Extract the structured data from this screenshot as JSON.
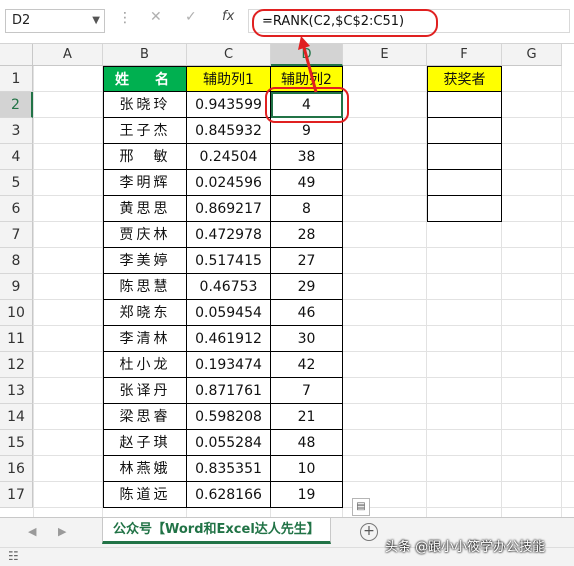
{
  "name_box": "D2",
  "formula": "=RANK(C2,$C$2:C51)",
  "columns": [
    "A",
    "B",
    "C",
    "D",
    "E",
    "F",
    "G"
  ],
  "rows": [
    "1",
    "2",
    "3",
    "4",
    "5",
    "6",
    "7",
    "8",
    "9",
    "10",
    "11",
    "12",
    "13",
    "14",
    "15",
    "16",
    "17"
  ],
  "headers": {
    "name": "姓　名",
    "aux1": "辅助列1",
    "aux2": "辅助列2",
    "winner": "获奖者"
  },
  "data_rows": [
    {
      "name": "张晓玲",
      "aux1": "0.943599",
      "aux2": "4"
    },
    {
      "name": "王子杰",
      "aux1": "0.845932",
      "aux2": "9"
    },
    {
      "name": "邢　敏",
      "aux1": "0.24504",
      "aux2": "38"
    },
    {
      "name": "李明辉",
      "aux1": "0.024596",
      "aux2": "49"
    },
    {
      "name": "黄思思",
      "aux1": "0.869217",
      "aux2": "8"
    },
    {
      "name": "贾庆林",
      "aux1": "0.472978",
      "aux2": "28"
    },
    {
      "name": "李美婷",
      "aux1": "0.517415",
      "aux2": "27"
    },
    {
      "name": "陈思慧",
      "aux1": "0.46753",
      "aux2": "29"
    },
    {
      "name": "郑晓东",
      "aux1": "0.059454",
      "aux2": "46"
    },
    {
      "name": "李清林",
      "aux1": "0.461912",
      "aux2": "30"
    },
    {
      "name": "杜小龙",
      "aux1": "0.193474",
      "aux2": "42"
    },
    {
      "name": "张译丹",
      "aux1": "0.871761",
      "aux2": "7"
    },
    {
      "name": "梁思睿",
      "aux1": "0.598208",
      "aux2": "21"
    },
    {
      "name": "赵子琪",
      "aux1": "0.055284",
      "aux2": "48"
    },
    {
      "name": "林燕娥",
      "aux1": "0.835351",
      "aux2": "10"
    },
    {
      "name": "陈道远",
      "aux1": "0.628166",
      "aux2": "19"
    }
  ],
  "sheet_tab": "公众号【Word和Excel达人先生】",
  "watermark": "头条 @跟小小筱学办公技能",
  "colors": {
    "excel_green": "#217346",
    "header_green": "#00b050",
    "header_yellow": "#ffff00",
    "annotation_red": "#e02020"
  }
}
